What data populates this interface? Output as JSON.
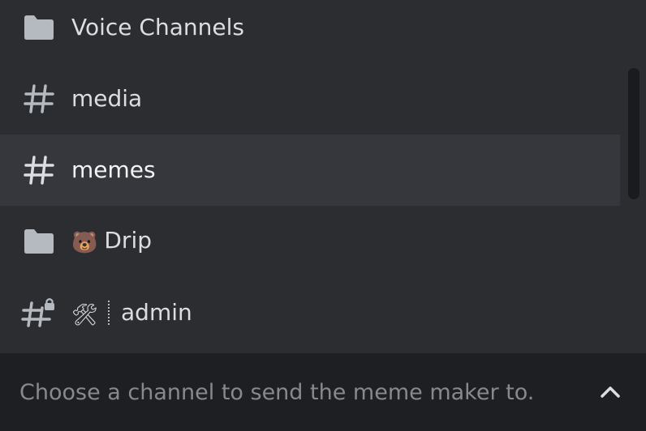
{
  "channels": [
    {
      "type": "folder",
      "icon": "folder-icon",
      "emoji": "",
      "label": "Voice Channels",
      "selected": false
    },
    {
      "type": "text",
      "icon": "hashtag-icon",
      "emoji": "",
      "label": "media",
      "selected": false
    },
    {
      "type": "text",
      "icon": "hashtag-icon",
      "emoji": "",
      "label": "memes",
      "selected": true
    },
    {
      "type": "folder",
      "icon": "folder-icon",
      "emoji": "🐻",
      "label": "Drip",
      "selected": false
    },
    {
      "type": "locked-text",
      "icon": "locked-hashtag-icon",
      "emoji": "🛠",
      "label": "admin",
      "selected": false
    }
  ],
  "select": {
    "placeholder": "Choose a channel to send the meme maker to.",
    "toggle_icon": "chevron-up-icon"
  },
  "colors": {
    "background": "#2b2d31",
    "selected_row": "#35373c",
    "footer": "#1e1f22",
    "icon": "#b5bac1",
    "text": "#dbdee1"
  }
}
